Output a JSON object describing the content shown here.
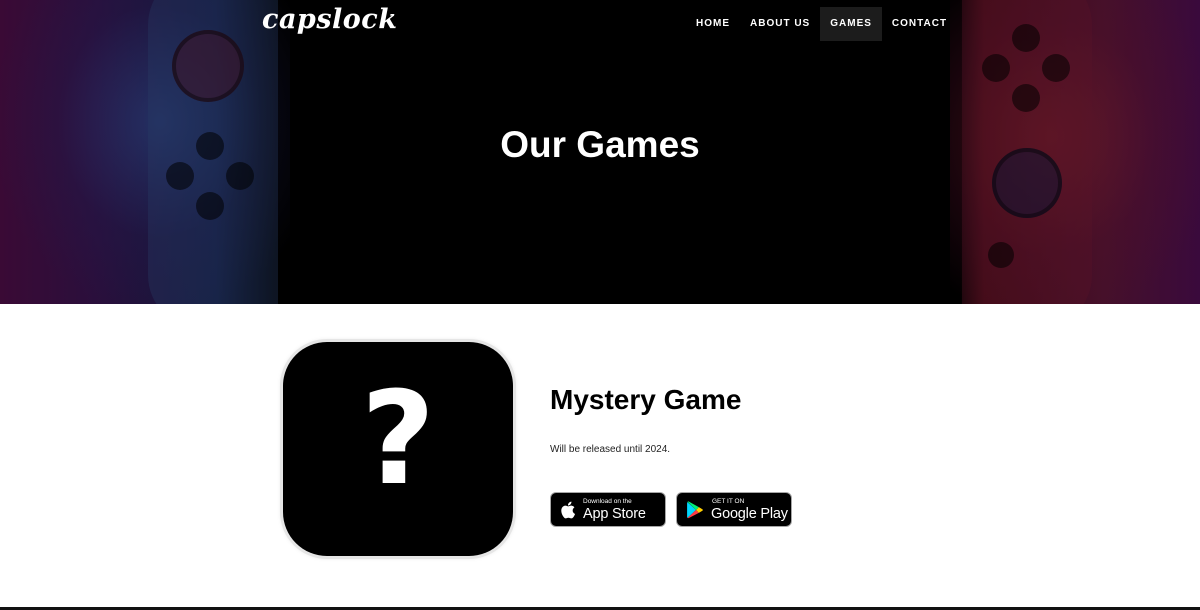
{
  "brand": {
    "logo_text": "capslock"
  },
  "nav": {
    "items": [
      {
        "label": "HOME",
        "active": false
      },
      {
        "label": "ABOUT US",
        "active": false
      },
      {
        "label": "GAMES",
        "active": true
      },
      {
        "label": "CONTACT",
        "active": false
      }
    ]
  },
  "hero": {
    "title": "Our Games"
  },
  "game": {
    "icon_symbol": "?",
    "title": "Mystery Game",
    "description": "Will be released until 2024."
  },
  "stores": {
    "apple": {
      "small_text": "Download on the",
      "big_text": "App Store",
      "icon": "apple-icon"
    },
    "google": {
      "small_text": "GET IT ON",
      "big_text": "Google Play",
      "icon": "google-play-icon"
    }
  },
  "colors": {
    "page_bg": "#ffffff",
    "hero_bg": "#000000",
    "nav_active_bg": "#1c1c1c",
    "text_dark": "#000000",
    "text_light": "#ffffff"
  }
}
